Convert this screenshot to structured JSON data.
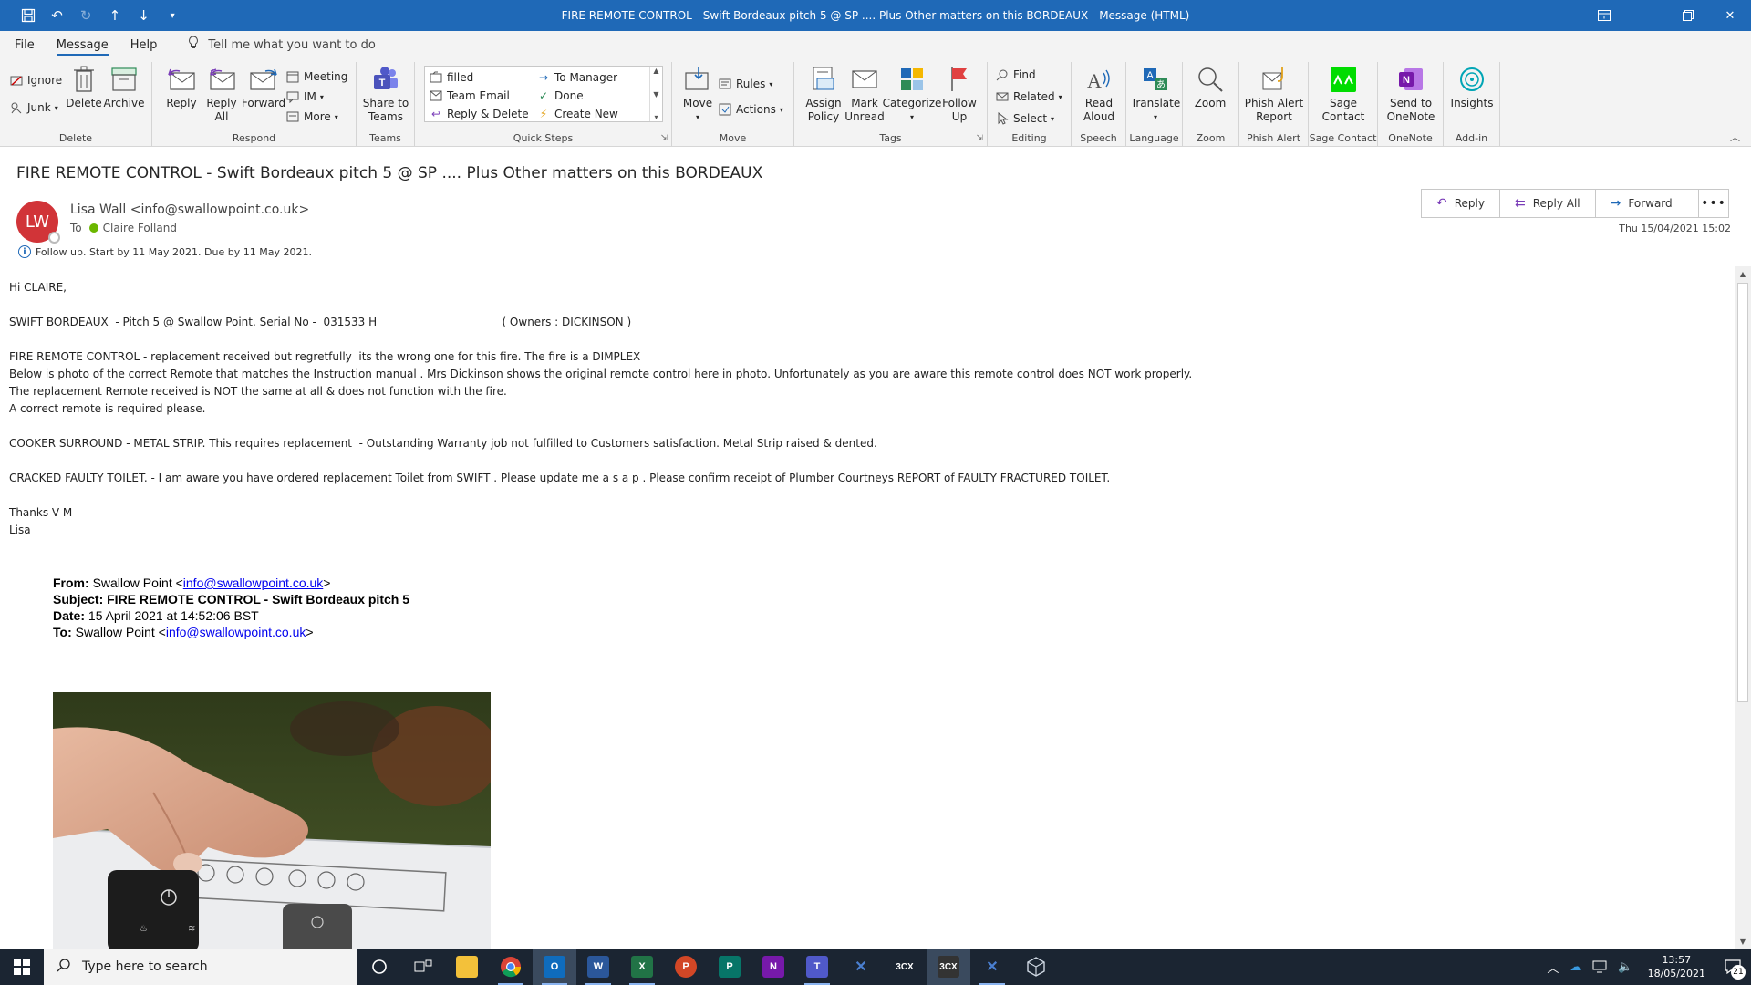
{
  "window": {
    "title": "FIRE REMOTE CONTROL - Swift Bordeaux pitch 5 @ SP .... Plus Other matters on this BORDEAUX  -  Message (HTML)"
  },
  "menu": {
    "file": "File",
    "message": "Message",
    "help": "Help",
    "tell_me": "Tell me what you want to do"
  },
  "ribbon": {
    "delete_group": {
      "ignore": "Ignore",
      "junk": "Junk",
      "delete": "Delete",
      "archive": "Archive",
      "label": "Delete"
    },
    "respond_group": {
      "reply": "Reply",
      "reply_all_1": "Reply",
      "reply_all_2": "All",
      "forward": "Forward",
      "meeting": "Meeting",
      "im": "IM",
      "more": "More",
      "label": "Respond"
    },
    "teams_group": {
      "share_1": "Share to",
      "share_2": "Teams",
      "label": "Teams"
    },
    "quick_steps": {
      "items": [
        "filled",
        "To Manager",
        "Team Email",
        "Done",
        "Reply & Delete",
        "Create New"
      ],
      "label": "Quick Steps"
    },
    "move_group": {
      "move": "Move",
      "rules": "Rules",
      "actions": "Actions",
      "label": "Move"
    },
    "tags_group": {
      "assign_1": "Assign",
      "assign_2": "Policy",
      "mark_1": "Mark",
      "mark_2": "Unread",
      "categorize": "Categorize",
      "follow_1": "Follow",
      "follow_2": "Up",
      "label": "Tags"
    },
    "editing_group": {
      "find": "Find",
      "related": "Related",
      "select": "Select",
      "label": "Editing"
    },
    "speech_group": {
      "read_1": "Read",
      "read_2": "Aloud",
      "label": "Speech"
    },
    "language_group": {
      "translate": "Translate",
      "label": "Language"
    },
    "zoom_group": {
      "zoom": "Zoom",
      "label": "Zoom"
    },
    "phish_group": {
      "btn_1": "Phish Alert",
      "btn_2": "Report",
      "label": "Phish Alert"
    },
    "sage_group": {
      "btn_1": "Sage",
      "btn_2": "Contact",
      "label": "Sage Contact"
    },
    "onenote_group": {
      "btn_1": "Send to",
      "btn_2": "OneNote",
      "label": "OneNote"
    },
    "addin_group": {
      "btn": "Insights",
      "label": "Add-in"
    }
  },
  "message": {
    "subject": "FIRE REMOTE CONTROL - Swift Bordeaux pitch 5 @ SP .... Plus Other matters on this BORDEAUX",
    "avatar_initials": "LW",
    "sender": "Lisa Wall <info@swallowpoint.co.uk>",
    "to_label": "To",
    "recipient": "Claire Folland",
    "followup": "Follow up.  Start by 11 May 2021.  Due by 11 May 2021.",
    "date": "Thu 15/04/2021 15:02",
    "actions": {
      "reply": "Reply",
      "reply_all": "Reply All",
      "forward": "Forward"
    },
    "body": {
      "greeting": "Hi CLAIRE,",
      "line_swift": "SWIFT BORDEAUX  - Pitch 5 @ Swallow Point. Serial No -  031533 H                                    ( Owners : DICKINSON )",
      "fire_1": "FIRE REMOTE CONTROL - replacement received but regretfully  its the wrong one for this fire. The fire is a DIMPLEX",
      "fire_2": "Below is photo of the correct Remote that matches the Instruction manual . Mrs Dickinson shows the original remote control here in photo. Unfortunately as you are aware this remote control does NOT work properly.",
      "fire_3": "The replacement Remote received is NOT the same at all & does not function with the fire.",
      "fire_4": "A correct remote is required please.",
      "cooker": "COOKER SURROUND - METAL STRIP. This requires replacement  - Outstanding Warranty job not fulfilled to Customers satisfaction. Metal Strip raised & dented.",
      "toilet": "CRACKED FAULTY TOILET. - I am aware you have ordered replacement Toilet from SWIFT . Please update me a s a p . Please confirm receipt of Plumber Courtneys REPORT of FAULTY FRACTURED TOILET.",
      "thanks": "Thanks V M",
      "name": "Lisa"
    },
    "quoted": {
      "from_label": "From:",
      "from_name": "Swallow Point <",
      "from_email": "info@swallowpoint.co.uk",
      "from_end": ">",
      "subject_label": "Subject:",
      "subject_value": "FIRE REMOTE CONTROL - Swift Bordeaux pitch 5",
      "date_label": "Date:",
      "date_value": "15 April 2021 at 14:52:06 BST",
      "to_label": "To:",
      "to_name": "Swallow Point <",
      "to_email": "info@swallowpoint.co.uk",
      "to_end": ">"
    }
  },
  "taskbar": {
    "search_placeholder": "Type here to search",
    "apps": [
      "task-view",
      "file-explorer",
      "chrome",
      "outlook",
      "word",
      "excel",
      "powerpoint",
      "publisher",
      "onenote",
      "teams",
      "3cx-blue",
      "3cx",
      "3cx-dark",
      "app-blue",
      "virtualbox"
    ],
    "time": "13:57",
    "date": "18/05/2021",
    "notifications": "21"
  }
}
